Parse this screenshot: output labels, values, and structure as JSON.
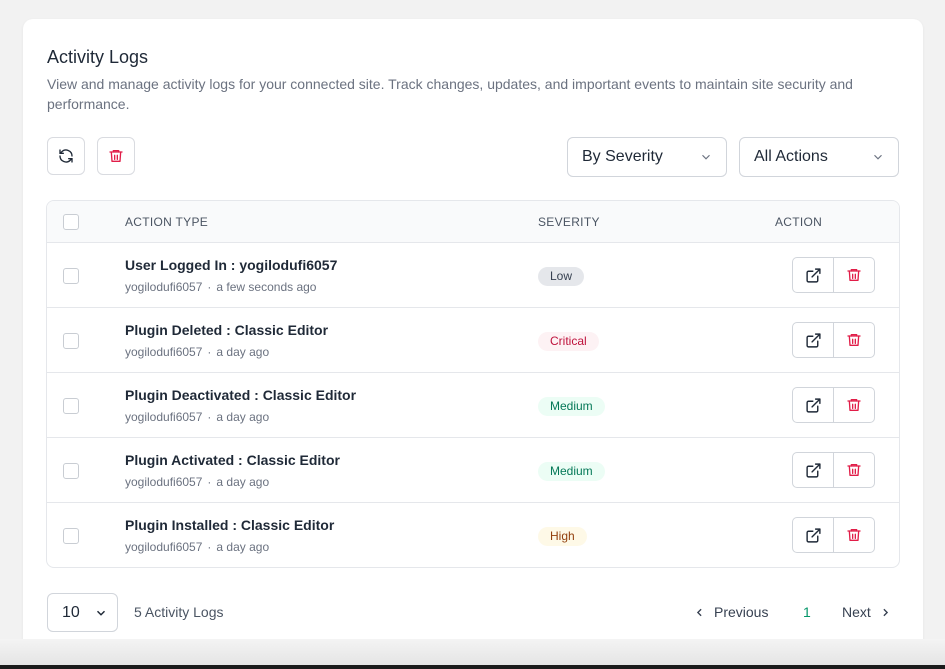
{
  "header": {
    "title": "Activity Logs",
    "description": "View and manage activity logs for your connected site. Track changes, updates, and important events to maintain site security and performance."
  },
  "toolbar": {
    "refresh_icon": "refresh-icon",
    "delete_icon": "trash-icon",
    "severity_filter": "By Severity",
    "action_filter": "All Actions"
  },
  "table": {
    "columns": {
      "action_type": "ACTION TYPE",
      "severity": "SEVERITY",
      "action": "ACTION"
    },
    "rows": [
      {
        "title": "User Logged In : yogilodufi6057",
        "user": "yogilodufi6057",
        "time": "a few seconds ago",
        "severity": "Low"
      },
      {
        "title": "Plugin Deleted : Classic Editor",
        "user": "yogilodufi6057",
        "time": "a day ago",
        "severity": "Critical"
      },
      {
        "title": "Plugin Deactivated : Classic Editor",
        "user": "yogilodufi6057",
        "time": "a day ago",
        "severity": "Medium"
      },
      {
        "title": "Plugin Activated : Classic Editor",
        "user": "yogilodufi6057",
        "time": "a day ago",
        "severity": "Medium"
      },
      {
        "title": "Plugin Installed : Classic Editor",
        "user": "yogilodufi6057",
        "time": "a day ago",
        "severity": "High"
      }
    ],
    "separator": "·"
  },
  "severity_colors": {
    "Low": {
      "bg": "#e5e7eb",
      "fg": "#374151"
    },
    "Critical": {
      "bg": "#fdf2f4",
      "fg": "#be123c"
    },
    "Medium": {
      "bg": "#ecfdf5",
      "fg": "#047857"
    },
    "High": {
      "bg": "#fef9e7",
      "fg": "#92400e"
    }
  },
  "footer": {
    "page_size": "10",
    "count_text": "5 Activity Logs",
    "previous_label": "Previous",
    "current_page": "1",
    "next_label": "Next"
  },
  "colors": {
    "accent": "#059669",
    "danger": "#e11d48"
  }
}
